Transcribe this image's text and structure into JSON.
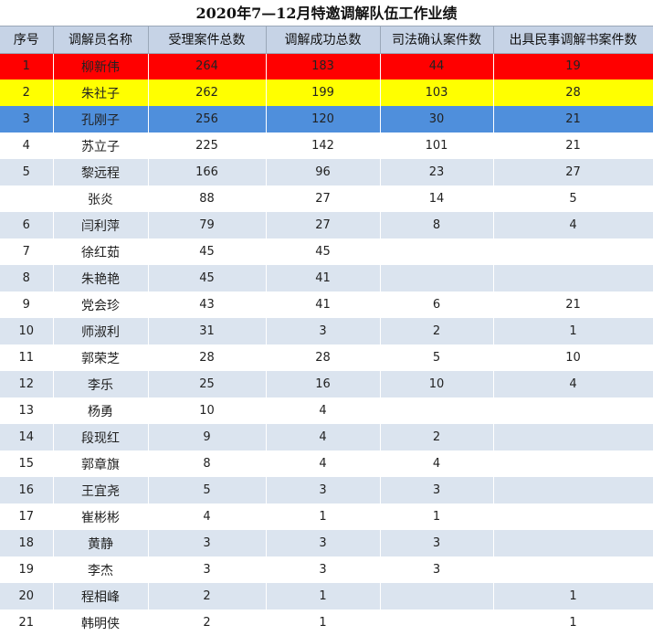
{
  "title": "2020年7—12月特邀调解队伍工作业绩",
  "columns": [
    "序号",
    "调解员名称",
    "受理案件总数",
    "调解成功总数",
    "司法确认案件数",
    "出具民事调解书案件数"
  ],
  "rows": [
    {
      "seq": "1",
      "name": "柳新伟",
      "accepted": "264",
      "success": "183",
      "confirmed": "44",
      "documents": "19"
    },
    {
      "seq": "2",
      "name": "朱社子",
      "accepted": "262",
      "success": "199",
      "confirmed": "103",
      "documents": "28"
    },
    {
      "seq": "3",
      "name": "孔刚子",
      "accepted": "256",
      "success": "120",
      "confirmed": "30",
      "documents": "21"
    },
    {
      "seq": "4",
      "name": "苏立子",
      "accepted": "225",
      "success": "142",
      "confirmed": "101",
      "documents": "21"
    },
    {
      "seq": "5",
      "name": "黎远程",
      "accepted": "166",
      "success": "96",
      "confirmed": "23",
      "documents": "27"
    },
    {
      "seq": "",
      "name": "张炎",
      "accepted": "88",
      "success": "27",
      "confirmed": "14",
      "documents": "5"
    },
    {
      "seq": "6",
      "name": "闫利萍",
      "accepted": "79",
      "success": "27",
      "confirmed": "8",
      "documents": "4"
    },
    {
      "seq": "7",
      "name": "徐红茹",
      "accepted": "45",
      "success": "45",
      "confirmed": "",
      "documents": ""
    },
    {
      "seq": "8",
      "name": "朱艳艳",
      "accepted": "45",
      "success": "41",
      "confirmed": "",
      "documents": ""
    },
    {
      "seq": "9",
      "name": "党会珍",
      "accepted": "43",
      "success": "41",
      "confirmed": "6",
      "documents": "21"
    },
    {
      "seq": "10",
      "name": "师淑利",
      "accepted": "31",
      "success": "3",
      "confirmed": "2",
      "documents": "1"
    },
    {
      "seq": "11",
      "name": "郭荣芝",
      "accepted": "28",
      "success": "28",
      "confirmed": "5",
      "documents": "10"
    },
    {
      "seq": "12",
      "name": "李乐",
      "accepted": "25",
      "success": "16",
      "confirmed": "10",
      "documents": "4"
    },
    {
      "seq": "13",
      "name": "杨勇",
      "accepted": "10",
      "success": "4",
      "confirmed": "",
      "documents": ""
    },
    {
      "seq": "14",
      "name": "段现红",
      "accepted": "9",
      "success": "4",
      "confirmed": "2",
      "documents": ""
    },
    {
      "seq": "15",
      "name": "郭章旗",
      "accepted": "8",
      "success": "4",
      "confirmed": "4",
      "documents": ""
    },
    {
      "seq": "16",
      "name": "王宜尧",
      "accepted": "5",
      "success": "3",
      "confirmed": "3",
      "documents": ""
    },
    {
      "seq": "17",
      "name": "崔彬彬",
      "accepted": "4",
      "success": "1",
      "confirmed": "1",
      "documents": ""
    },
    {
      "seq": "18",
      "name": "黄静",
      "accepted": "3",
      "success": "3",
      "confirmed": "3",
      "documents": ""
    },
    {
      "seq": "19",
      "name": "李杰",
      "accepted": "3",
      "success": "3",
      "confirmed": "3",
      "documents": ""
    },
    {
      "seq": "20",
      "name": "程相峰",
      "accepted": "2",
      "success": "1",
      "confirmed": "",
      "documents": "1"
    },
    {
      "seq": "21",
      "name": "韩明侠",
      "accepted": "2",
      "success": "1",
      "confirmed": "",
      "documents": "1"
    }
  ],
  "highlight_colors": {
    "row_1": "#ff0000",
    "row_2": "#ffff00",
    "row_3": "#4f8fdc",
    "band": "#dbe4ef",
    "header": "#c6d3e6"
  }
}
